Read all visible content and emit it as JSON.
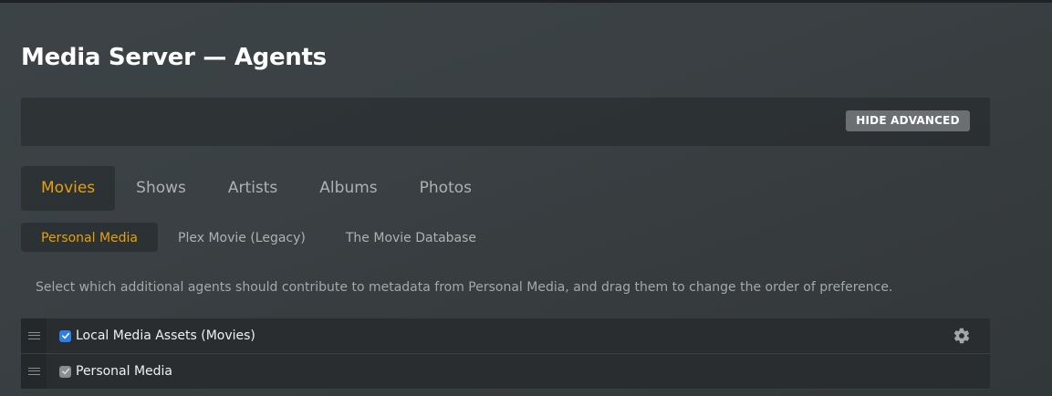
{
  "page": {
    "title": "Media Server — Agents"
  },
  "advanced": {
    "button_label": "HIDE ADVANCED"
  },
  "tabs": [
    {
      "label": "Movies",
      "active": true
    },
    {
      "label": "Shows",
      "active": false
    },
    {
      "label": "Artists",
      "active": false
    },
    {
      "label": "Albums",
      "active": false
    },
    {
      "label": "Photos",
      "active": false
    }
  ],
  "subtabs": [
    {
      "label": "Personal Media",
      "active": true
    },
    {
      "label": "Plex Movie (Legacy)",
      "active": false
    },
    {
      "label": "The Movie Database",
      "active": false
    }
  ],
  "helper_text": "Select which additional agents should contribute to metadata from Personal Media, and drag them to change the order of preference.",
  "agents": [
    {
      "label": "Local Media Assets (Movies)",
      "checked": true,
      "checkbox_style": "blue",
      "has_settings": true
    },
    {
      "label": "Personal Media",
      "checked": true,
      "checkbox_style": "grey",
      "has_settings": false
    }
  ],
  "colors": {
    "accent": "#e5a00d",
    "checkbox_active": "#2d7fe6",
    "checkbox_disabled": "#8a8c8e"
  },
  "icons": {
    "drag_handle": "hamburger-icon",
    "settings": "gear-icon",
    "check": "checkmark-icon"
  }
}
